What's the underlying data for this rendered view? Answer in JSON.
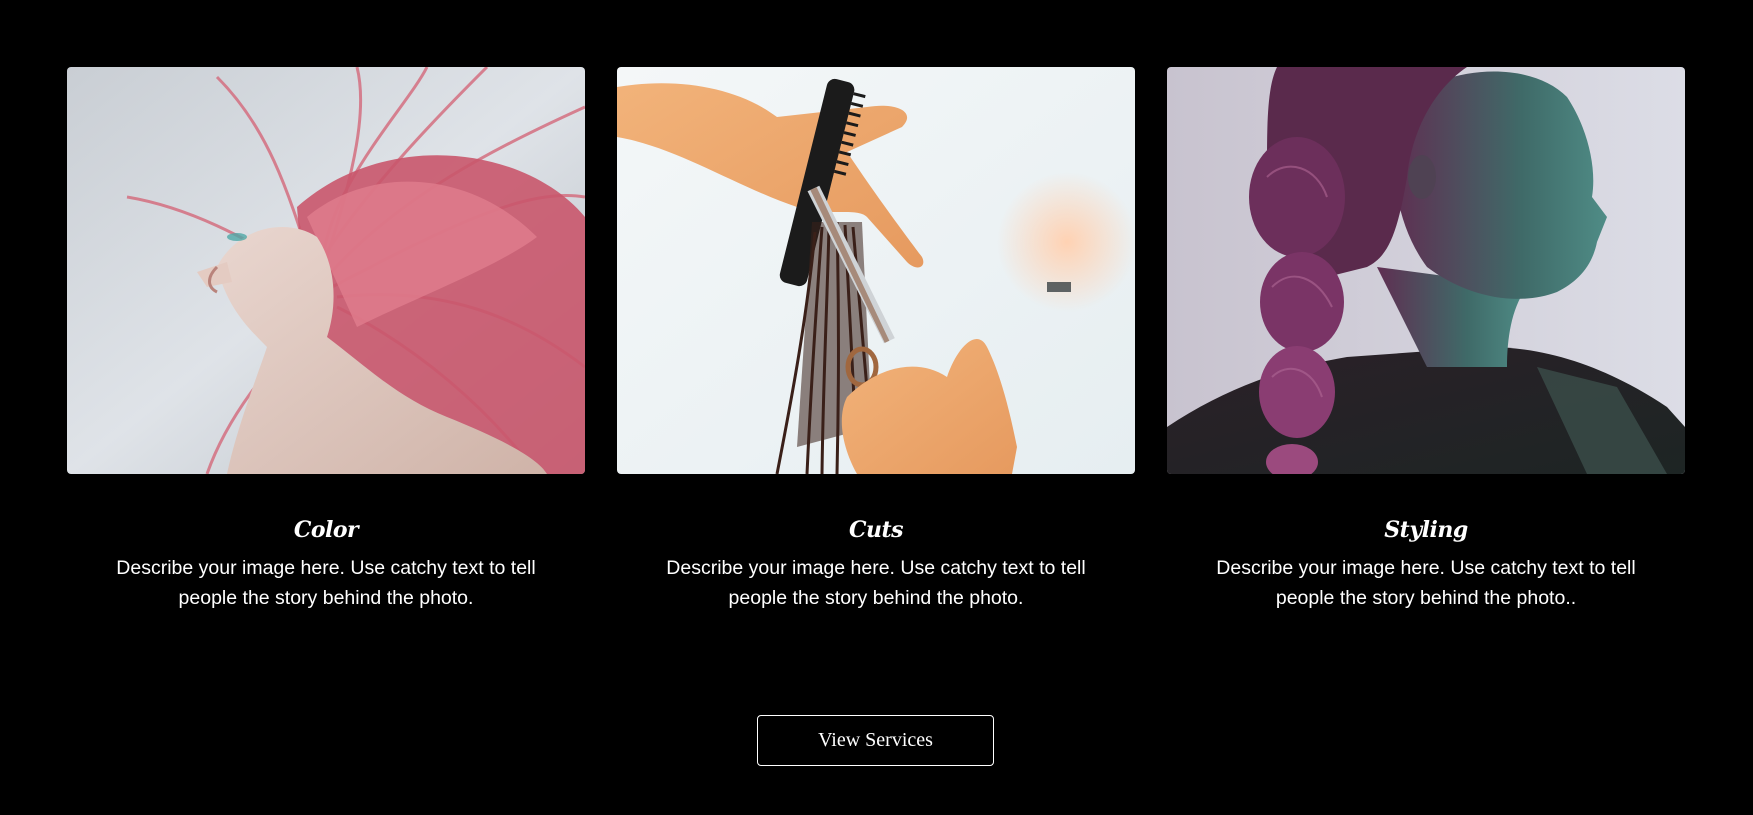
{
  "cards": [
    {
      "title": "Color",
      "description": "Describe your image here. Use catchy text to tell people the story behind the photo.",
      "image": "pink-hair-woman-photo"
    },
    {
      "title": "Cuts",
      "description": "Describe your image here. Use catchy text to tell people the story behind the photo.",
      "image": "haircut-scissors-comb-photo"
    },
    {
      "title": "Styling",
      "description": "Describe your image here. Use catchy text to tell people the story behind the photo..",
      "image": "braided-hair-woman-photo"
    }
  ],
  "cta": {
    "label": "View Services"
  },
  "colors": {
    "background": "#000000",
    "text": "#ffffff",
    "button_border": "#ffffff"
  }
}
